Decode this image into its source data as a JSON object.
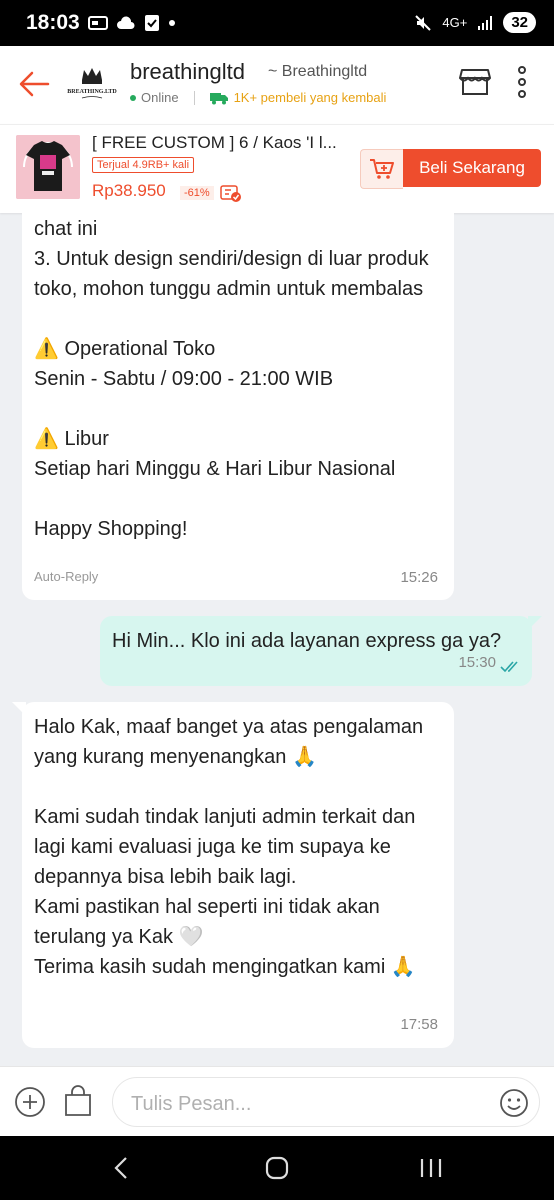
{
  "status_bar": {
    "time": "18:03",
    "network": "4G+",
    "battery": "32"
  },
  "header": {
    "shop_name": "breathingltd",
    "shop_handle": "~ Breathingltd",
    "online": "Online",
    "returning_buyers": "1K+ pembeli yang kembali",
    "logo_text": "BREATHING.LTD"
  },
  "product": {
    "title": "[ FREE CUSTOM ] 6 / Kaos 'I l...",
    "sold": "Terjual 4.9RB+ kali",
    "price": "Rp38.950",
    "discount": "-61%",
    "buy_label": "Beli Sekarang"
  },
  "messages": [
    {
      "side": "left",
      "text": "chat ini\n3. Untuk design sendiri/design di luar produk toko, mohon tunggu admin untuk membalas\n\n⚠️ Operational Toko\nSenin - Sabtu / 09:00 - 21:00 WIB\n\n⚠️ Libur\nSetiap hari Minggu & Hari Libur Nasional\n\nHappy Shopping!",
      "meta": "Auto-Reply",
      "time": "15:26"
    },
    {
      "side": "right",
      "text": "Hi Min... Klo ini ada layanan express ga ya?",
      "time": "15:30"
    },
    {
      "side": "left",
      "text": "Halo Kak, maaf banget ya atas pengalaman yang kurang menyenangkan 🙏\n\nKami sudah tindak lanjuti admin terkait dan lagi kami evaluasi juga ke tim supaya ke depannya bisa lebih baik lagi.\nKami pastikan hal seperti ini tidak akan terulang ya Kak 🤍\nTerima kasih sudah mengingatkan kami 🙏",
      "time": "17:58"
    }
  ],
  "input": {
    "placeholder": "Tulis Pesan..."
  },
  "colors": {
    "brand": "#ee4d2d",
    "sent_bubble": "#d7f6ef",
    "online": "#26aa5d",
    "returning": "#e7a214"
  }
}
